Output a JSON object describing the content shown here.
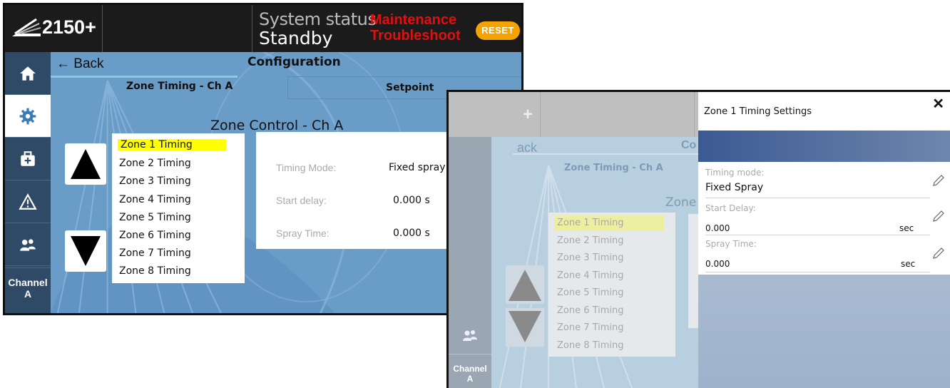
{
  "brand": {
    "model": "2150+",
    "logo_icon": "spray-logo-icon"
  },
  "status": {
    "label": "System status",
    "value": "Standby",
    "alert_line1": "Maintenance",
    "alert_line2": "Troubleshoot",
    "reset_label": "RESET",
    "alert_color": "#e01010",
    "reset_color": "#f5a300"
  },
  "sidebar": {
    "items": [
      {
        "icon": "home-icon"
      },
      {
        "icon": "gear-icon"
      },
      {
        "icon": "toolbox-icon"
      },
      {
        "icon": "warning-icon"
      },
      {
        "icon": "users-icon"
      }
    ],
    "channel_line1": "Channel",
    "channel_line2": "A"
  },
  "nav": {
    "back_label": "Back",
    "title": "Configuration"
  },
  "tabs": [
    {
      "label": "Zone Timing - Ch A"
    },
    {
      "label": "Setpoint"
    }
  ],
  "zone_control": {
    "title": "Zone Control - Ch A",
    "zones": [
      "Zone 1 Timing",
      "Zone 2 Timing",
      "Zone 3 Timing",
      "Zone 4 Timing",
      "Zone 5 Timing",
      "Zone 6 Timing",
      "Zone 7 Timing",
      "Zone 8 Timing"
    ],
    "selected_index": 0,
    "highlight_color": "#ffff00"
  },
  "details": {
    "rows": [
      {
        "label": "Timing Mode:",
        "value": "Fixed spray"
      },
      {
        "label": "Start delay:",
        "value": "0.000 s"
      },
      {
        "label": "Spray Time:",
        "value": "0.000 s"
      }
    ]
  },
  "screen2_bg": {
    "back_fragment": "ack",
    "title_fragment": "Co",
    "zone_fragment": "Zone",
    "plus_fragment": "+"
  },
  "modal": {
    "title": "Zone 1 Timing Settings",
    "close_label": "✕",
    "fields": [
      {
        "label": "Timing mode:",
        "value": "Fixed Spray",
        "unit": ""
      },
      {
        "label": "Start Delay:",
        "value": "0.000",
        "unit": "sec"
      },
      {
        "label": "Spray Time:",
        "value": "0.000",
        "unit": "sec"
      }
    ]
  }
}
